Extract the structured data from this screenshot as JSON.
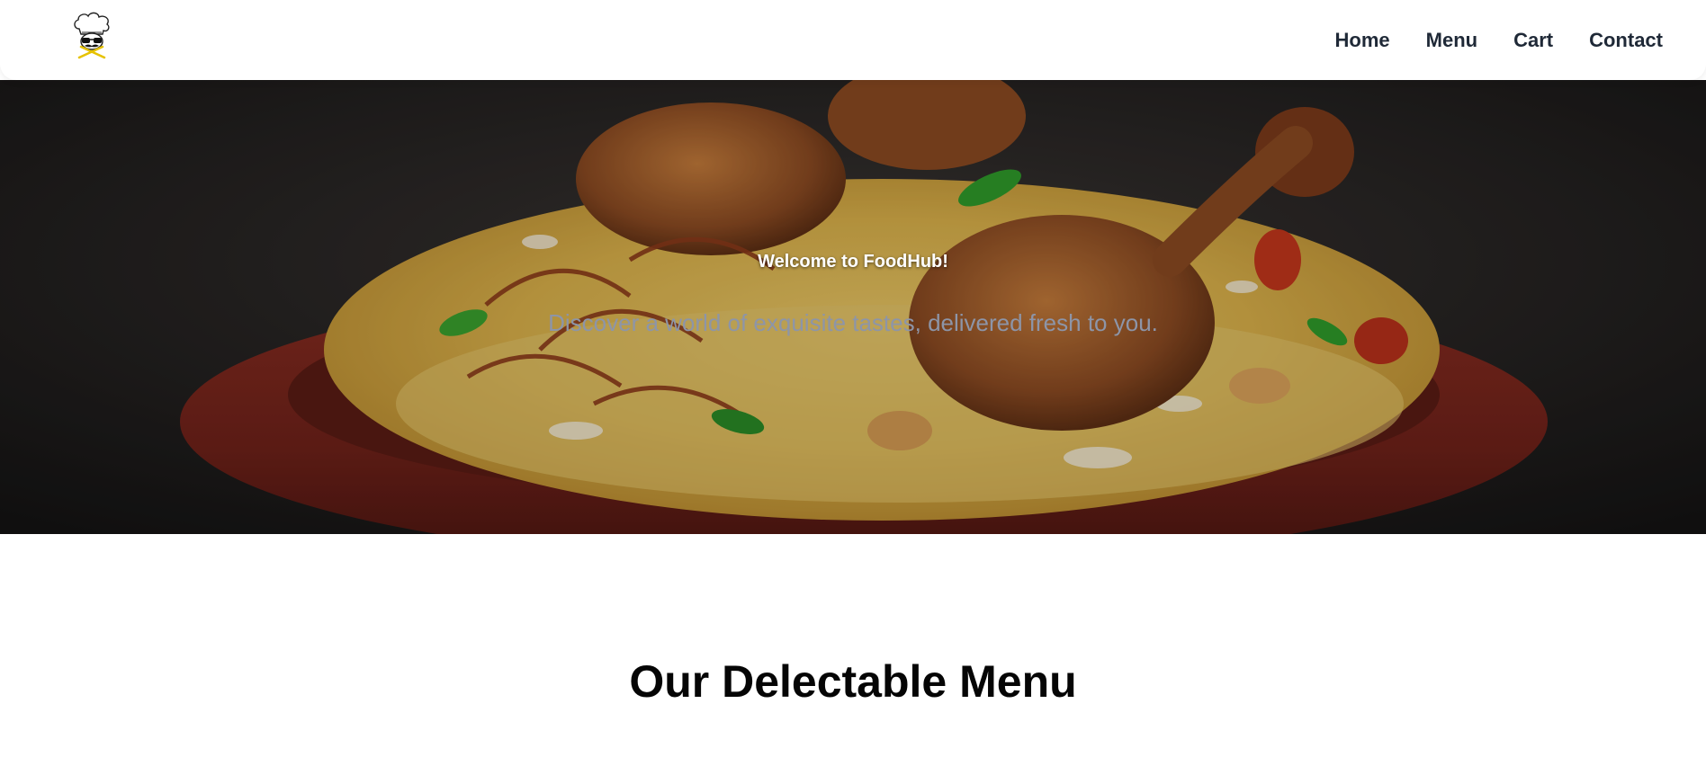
{
  "header": {
    "logo_icon": "chef-hat-logo-icon",
    "nav": [
      {
        "label": "Home"
      },
      {
        "label": "Menu"
      },
      {
        "label": "Cart"
      },
      {
        "label": "Contact"
      }
    ]
  },
  "hero": {
    "image": "biryani-plate-photo",
    "title": "Welcome to FoodHub!",
    "subtitle": "Discover a world of exquisite tastes, delivered fresh to you."
  },
  "menu_section": {
    "title": "Our Delectable Menu"
  },
  "colors": {
    "nav_text": "#1f2937",
    "hero_subtitle": "#8d95a8",
    "section_title": "#050505"
  }
}
